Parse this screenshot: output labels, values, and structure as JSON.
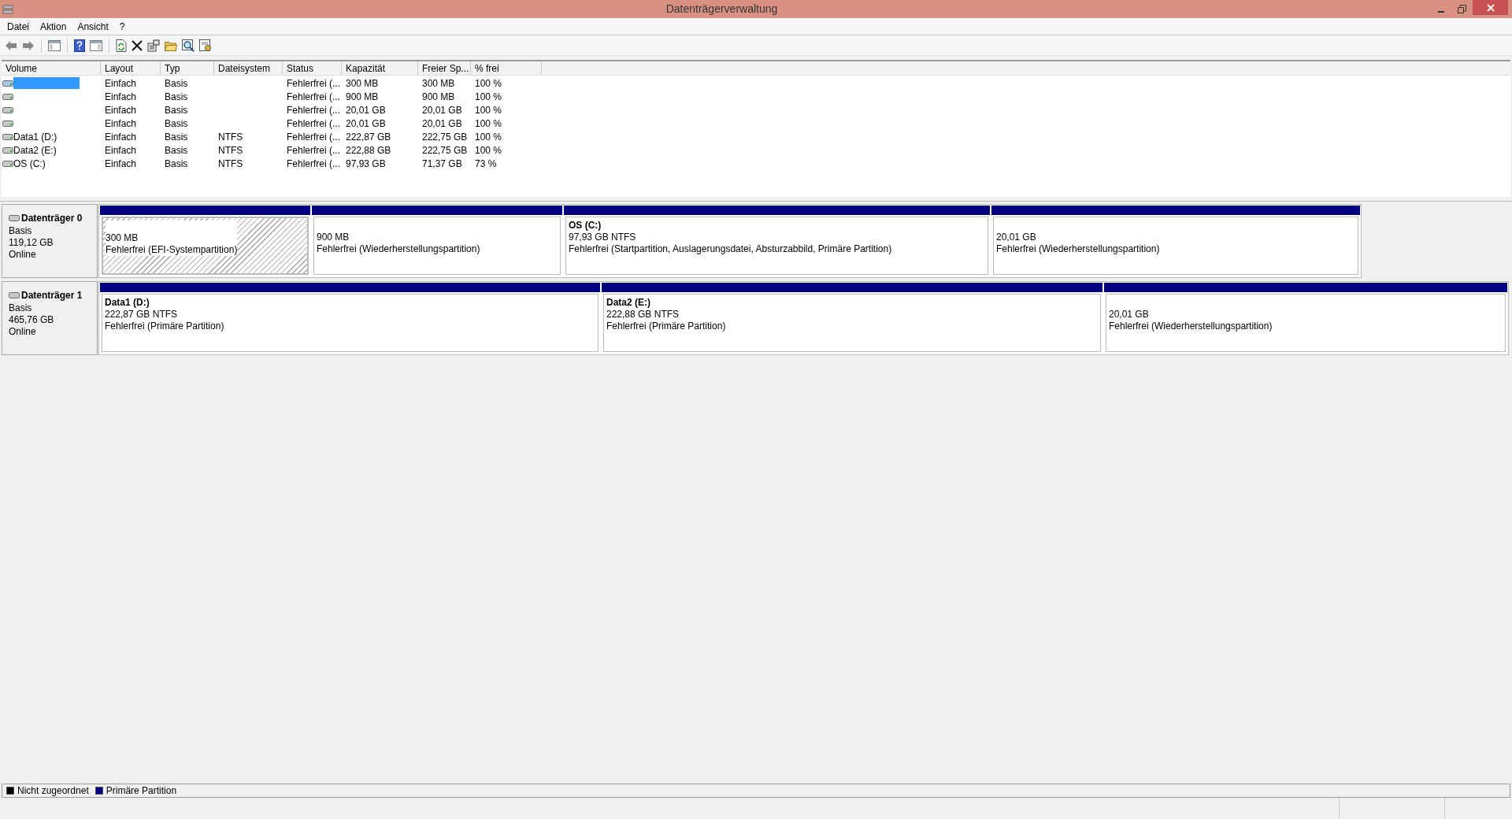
{
  "window": {
    "title": "Datenträgerverwaltung"
  },
  "menu": [
    "Datei",
    "Aktion",
    "Ansicht",
    "?"
  ],
  "table": {
    "columns": [
      "Volume",
      "Layout",
      "Typ",
      "Dateisystem",
      "Status",
      "Kapazität",
      "Freier Sp...",
      "% frei"
    ],
    "rows": [
      {
        "selected": true,
        "cells": [
          "",
          "Einfach",
          "Basis",
          "",
          "Fehlerfrei (...",
          "300 MB",
          "300 MB",
          "100 %"
        ]
      },
      {
        "selected": false,
        "cells": [
          "",
          "Einfach",
          "Basis",
          "",
          "Fehlerfrei (...",
          "900 MB",
          "900 MB",
          "100 %"
        ]
      },
      {
        "selected": false,
        "cells": [
          "",
          "Einfach",
          "Basis",
          "",
          "Fehlerfrei (...",
          "20,01 GB",
          "20,01 GB",
          "100 %"
        ]
      },
      {
        "selected": false,
        "cells": [
          "",
          "Einfach",
          "Basis",
          "",
          "Fehlerfrei (...",
          "20,01 GB",
          "20,01 GB",
          "100 %"
        ]
      },
      {
        "selected": false,
        "cells": [
          "Data1 (D:)",
          "Einfach",
          "Basis",
          "NTFS",
          "Fehlerfrei (...",
          "222,87 GB",
          "222,75 GB",
          "100 %"
        ]
      },
      {
        "selected": false,
        "cells": [
          "Data2 (E:)",
          "Einfach",
          "Basis",
          "NTFS",
          "Fehlerfrei (...",
          "222,88 GB",
          "222,75 GB",
          "100 %"
        ]
      },
      {
        "selected": false,
        "cells": [
          "OS (C:)",
          "Einfach",
          "Basis",
          "NTFS",
          "Fehlerfrei (...",
          "97,93 GB",
          "71,37 GB",
          "73 %"
        ]
      }
    ]
  },
  "disks": [
    {
      "name": "Datenträger 0",
      "type": "Basis",
      "size": "119,12 GB",
      "state": "Online",
      "partitions": [
        {
          "selected": true,
          "size": "300 MB",
          "status": "Fehlerfrei (EFI-Systempartition)"
        },
        {
          "selected": false,
          "size": "900 MB",
          "status": "Fehlerfrei (Wiederherstellungspartition)"
        },
        {
          "selected": false,
          "label": "OS  (C:)",
          "size": "97,93 GB NTFS",
          "status": "Fehlerfrei (Startpartition, Auslagerungsdatei, Absturzabbild, Primäre Partition)"
        },
        {
          "selected": false,
          "size": "20,01 GB",
          "status": "Fehlerfrei (Wiederherstellungspartition)"
        }
      ]
    },
    {
      "name": "Datenträger 1",
      "type": "Basis",
      "size": "465,76 GB",
      "state": "Online",
      "partitions": [
        {
          "selected": false,
          "label": "Data1  (D:)",
          "size": "222,87 GB NTFS",
          "status": "Fehlerfrei (Primäre Partition)"
        },
        {
          "selected": false,
          "label": "Data2  (E:)",
          "size": "222,88 GB NTFS",
          "status": "Fehlerfrei (Primäre Partition)"
        },
        {
          "selected": false,
          "size": "20,01 GB",
          "status": "Fehlerfrei (Wiederherstellungspartition)"
        }
      ]
    }
  ],
  "legend": [
    {
      "label": "Nicht zugeordnet",
      "color": "#000000"
    },
    {
      "label": "Primäre Partition",
      "color": "#000080"
    }
  ]
}
